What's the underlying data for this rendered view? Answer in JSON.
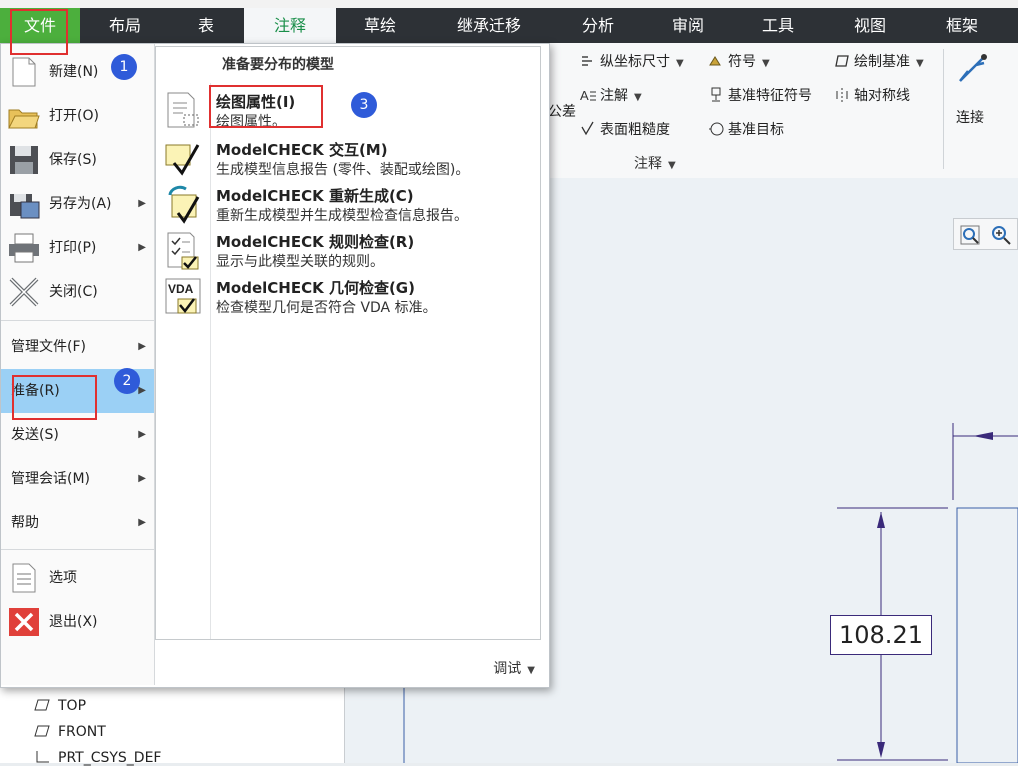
{
  "ribbon": {
    "tabs": [
      {
        "label": "文件"
      },
      {
        "label": "布局"
      },
      {
        "label": "表"
      },
      {
        "label": "注释"
      },
      {
        "label": "草绘"
      },
      {
        "label": "继承迁移"
      },
      {
        "label": "分析"
      },
      {
        "label": "审阅"
      },
      {
        "label": "工具"
      },
      {
        "label": "视图"
      },
      {
        "label": "框架"
      }
    ],
    "active_tab": "注释",
    "items": {
      "ordinate_dim": "纵坐标尺寸",
      "symbol": "符号",
      "draw_datum": "绘制基准",
      "connect": "连接",
      "note": "注解",
      "datum_feature_symbol": "基准特征符号",
      "axis_symmetry": "轴对称线",
      "tolerance": "公差",
      "surface_roughness": "表面粗糙度",
      "datum_target": "基准目标",
      "group_label": "注释"
    }
  },
  "file_menu": {
    "items": [
      {
        "label": "新建(N)"
      },
      {
        "label": "打开(O)"
      },
      {
        "label": "保存(S)"
      },
      {
        "label": "另存为(A)"
      },
      {
        "label": "打印(P)"
      },
      {
        "label": "关闭(C)"
      },
      {
        "label": "管理文件(F)"
      },
      {
        "label": "准备(R)"
      },
      {
        "label": "发送(S)"
      },
      {
        "label": "管理会话(M)"
      },
      {
        "label": "帮助"
      },
      {
        "label": "选项"
      },
      {
        "label": "退出(X)"
      }
    ],
    "submenu": {
      "header": "准备要分布的模型",
      "items": [
        {
          "title": "绘图属性(I)",
          "desc": "绘图属性。"
        },
        {
          "title": "ModelCHECK 交互(M)",
          "desc": "生成模型信息报告 (零件、装配或绘图)。"
        },
        {
          "title": "ModelCHECK 重新生成(C)",
          "desc": "重新生成模型并生成模型检查信息报告。"
        },
        {
          "title": "ModelCHECK 规则检查(R)",
          "desc": "显示与此模型关联的规则。"
        },
        {
          "title": "ModelCHECK 几何检查(G)",
          "desc": "检查模型几何是否符合 VDA 标准。"
        }
      ]
    },
    "footer_label": "调试"
  },
  "tree": {
    "items": [
      {
        "label": "TOP"
      },
      {
        "label": "FRONT"
      },
      {
        "label": "PRT_CSYS_DEF"
      }
    ]
  },
  "drawing": {
    "dimension_value": "108.21"
  },
  "annotations": {
    "badges": [
      "1",
      "2",
      "3"
    ]
  },
  "colors": {
    "accent_green": "#4caf3d",
    "highlight_blue": "#9bd0f5",
    "annotation_red": "#e03030",
    "badge_blue": "#2f5bd9"
  }
}
